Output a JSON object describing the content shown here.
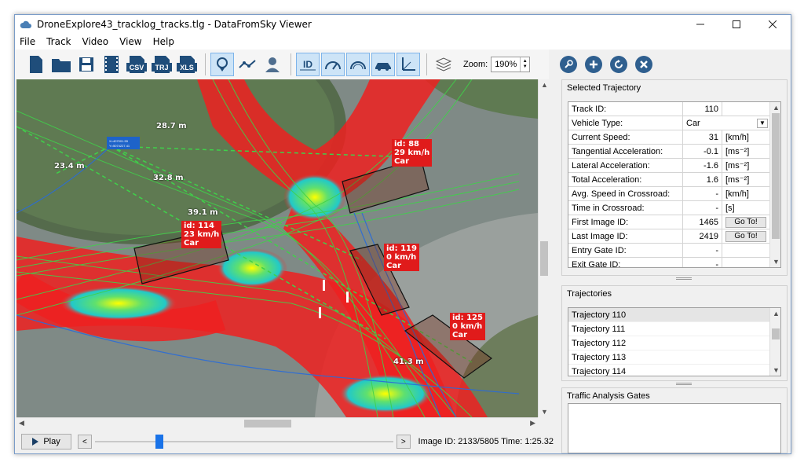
{
  "window": {
    "title": "DroneExplore43_tracklog_tracks.tlg - DataFromSky Viewer"
  },
  "menu": [
    "File",
    "Track",
    "Video",
    "View",
    "Help"
  ],
  "toolbar": {
    "zoom_label": "Zoom:",
    "zoom_value": "190%",
    "csv": "CSV",
    "trj": "TRJ",
    "xls": "XLS",
    "id": "ID"
  },
  "viewport": {
    "vehicles": [
      {
        "line1": "id: 88",
        "line2": "29 km/h",
        "line3": "Car"
      },
      {
        "line1": "id: 114",
        "line2": "23 km/h",
        "line3": "Car"
      },
      {
        "line1": "id: 119",
        "line2": "0 km/h",
        "line3": "Car"
      },
      {
        "line1": "id: 125",
        "line2": "0 km/h",
        "line3": "Car"
      }
    ],
    "distances": [
      "28.7 m",
      "23.4 m",
      "32.8 m",
      "39.1 m",
      "41.3 m"
    ],
    "coord_tooltip": {
      "x": "X=407001.55",
      "y": "Y=5074227.41"
    }
  },
  "playback": {
    "play": "Play",
    "prev": "<",
    "next": ">",
    "image_id_label": "Image ID:",
    "image_id": "2133/5805",
    "time_label": "Time:",
    "time": "1:25.32"
  },
  "panel": {
    "selected_title": "Selected Trajectory",
    "rows": [
      {
        "label": "Track ID:",
        "value": "110",
        "unit": ""
      },
      {
        "label": "Vehicle Type:",
        "value": "Car",
        "unit": ""
      },
      {
        "label": "Current Speed:",
        "value": "31",
        "unit": "[km/h]"
      },
      {
        "label": "Tangential Acceleration:",
        "value": "-0.1",
        "unit": "[ms⁻²]"
      },
      {
        "label": "Lateral Acceleration:",
        "value": "-1.6",
        "unit": "[ms⁻²]"
      },
      {
        "label": "Total Acceleration:",
        "value": "1.6",
        "unit": "[ms⁻²]"
      },
      {
        "label": "Avg. Speed in Crossroad:",
        "value": "-",
        "unit": "[km/h]"
      },
      {
        "label": "Time in Crossroad:",
        "value": "-",
        "unit": "[s]"
      },
      {
        "label": "First Image ID:",
        "value": "1465",
        "unit": "Go To!"
      },
      {
        "label": "Last Image ID:",
        "value": "2419",
        "unit": "Go To!"
      },
      {
        "label": "Entry Gate ID:",
        "value": "-",
        "unit": ""
      },
      {
        "label": "Exit Gate ID:",
        "value": "-",
        "unit": ""
      }
    ],
    "trajectories_title": "Trajectories",
    "trajectories": [
      "Trajectory 110",
      "Trajectory 111",
      "Trajectory 112",
      "Trajectory 113",
      "Trajectory 114"
    ],
    "gates_title": "Traffic Analysis Gates"
  }
}
